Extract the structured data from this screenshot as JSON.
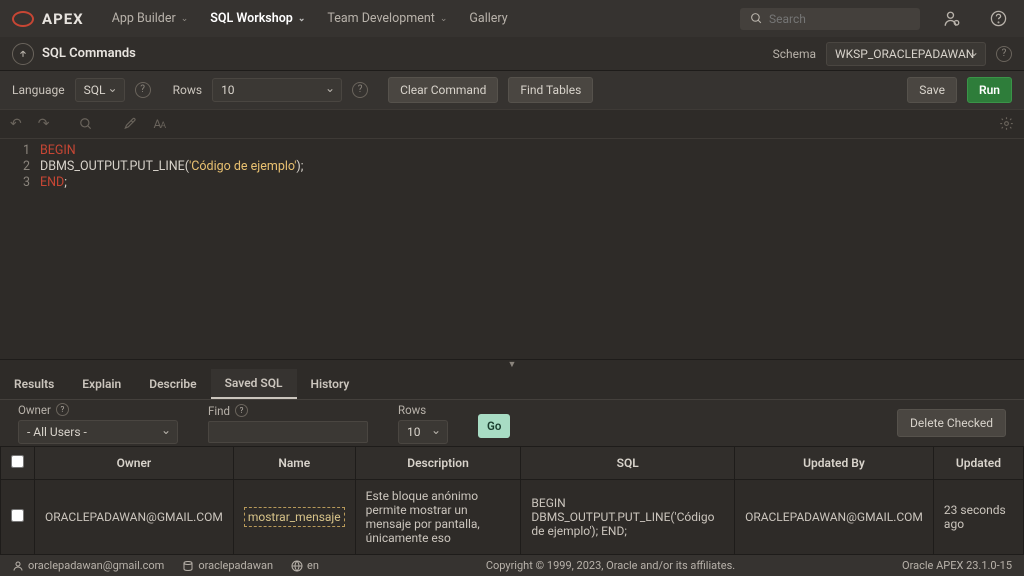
{
  "brand": "APEX",
  "nav": {
    "app_builder": "App Builder",
    "sql_workshop": "SQL Workshop",
    "team_dev": "Team Development",
    "gallery": "Gallery"
  },
  "search": {
    "placeholder": "Search"
  },
  "page": {
    "title": "SQL Commands",
    "schema_label": "Schema",
    "schema_value": "WKSP_ORACLEPADAWAN"
  },
  "cmd": {
    "language_label": "Language",
    "language_value": "SQL",
    "rows_label": "Rows",
    "rows_value": "10",
    "clear": "Clear Command",
    "find": "Find Tables",
    "save": "Save",
    "run": "Run"
  },
  "editor": {
    "lines": [
      "1",
      "2",
      "3"
    ]
  },
  "code": {
    "begin": "BEGIN",
    "put": "    DBMS_OUTPUT.PUT_LINE(",
    "str": "'Código de ejemplo'",
    "close": ");",
    "end": "END",
    "semi": ";"
  },
  "tabs": {
    "results": "Results",
    "explain": "Explain",
    "describe": "Describe",
    "saved": "Saved SQL",
    "history": "History"
  },
  "filters": {
    "owner_label": "Owner",
    "owner_value": "- All Users -",
    "find_label": "Find",
    "rows_label": "Rows",
    "rows_value": "10",
    "go": "Go",
    "delete": "Delete Checked"
  },
  "cols": {
    "owner": "Owner",
    "name": "Name",
    "desc": "Description",
    "sql": "SQL",
    "updatedby": "Updated By",
    "updated": "Updated"
  },
  "row": {
    "owner": "ORACLEPADAWAN@GMAIL.COM",
    "name": "mostrar_mensaje",
    "desc": "Este bloque anónimo permite mostrar un mensaje por pantalla, únicamente eso",
    "sql": "BEGIN DBMS_OUTPUT.PUT_LINE('Código de ejemplo'); END;",
    "updatedby": "ORACLEPADAWAN@GMAIL.COM",
    "updated": "23 seconds ago"
  },
  "footer": {
    "user": "oraclepadawan@gmail.com",
    "ws": "oraclepadawan",
    "lang": "en",
    "copy": "Copyright © 1999, 2023, Oracle and/or its affiliates.",
    "version": "Oracle APEX 23.1.0-15"
  }
}
